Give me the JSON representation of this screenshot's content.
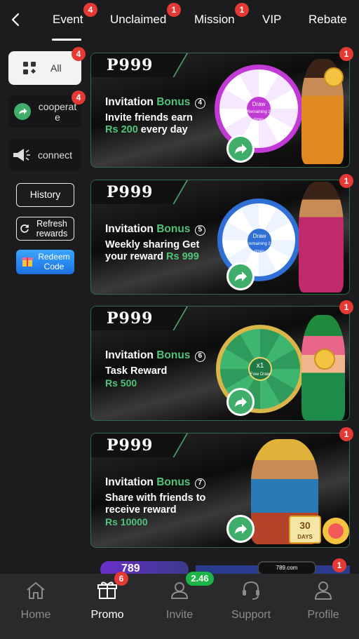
{
  "topbar": {
    "tabs": [
      {
        "label": "Event",
        "badge": "4",
        "active": true
      },
      {
        "label": "Unclaimed",
        "badge": "1"
      },
      {
        "label": "Mission",
        "badge": "1"
      },
      {
        "label": "VIP",
        "badge": ""
      },
      {
        "label": "Rebate",
        "badge": ""
      }
    ]
  },
  "sidebar": {
    "all": {
      "label": "All",
      "badge": "4"
    },
    "cooperate": {
      "label": "cooperat e",
      "badge": "4"
    },
    "connect": {
      "label": "connect"
    },
    "history": "History",
    "refresh": "Refresh rewards",
    "redeem": "Redeem Code"
  },
  "cards": [
    {
      "logo": "P999",
      "title_a": "Invitation ",
      "title_b": "Bonus",
      "num": "4",
      "line1": "Invite friends earn",
      "line2_a": "Rs 200",
      "line2_b": " every day",
      "amount": "",
      "badge": "1",
      "wheel_text": "Draw",
      "wheel_sub": "Remaining 2 times"
    },
    {
      "logo": "P999",
      "title_a": "Invitation ",
      "title_b": "Bonus",
      "num": "5",
      "line1": "Weekly sharing Get",
      "line2_a": "your reward ",
      "line2_b": "Rs 999",
      "amount": "",
      "badge": "1",
      "wheel_text": "Draw",
      "wheel_sub": "remaining 2 times"
    },
    {
      "logo": "P999",
      "title_a": "Invitation ",
      "title_b": "Bonus",
      "num": "6",
      "line1": "Task Reward",
      "line2_a": "",
      "line2_b": "",
      "amount": "Rs 500",
      "badge": "1",
      "wheel_text": "x1",
      "wheel_sub": "Free Draw"
    },
    {
      "logo": "P999",
      "title_a": "Invitation ",
      "title_b": "Bonus",
      "num": "7",
      "line1": "Share with friends to",
      "line2_a": "receive reward",
      "line2_b": "",
      "amount": "Rs 10000",
      "badge": "1",
      "wheel_text": "30",
      "wheel_sub": "DAYS"
    }
  ],
  "strip": {
    "text_left": "789",
    "text_right": "789.com",
    "badge": "1"
  },
  "bottomnav": {
    "items": [
      {
        "label": "Home",
        "icon": "home-icon"
      },
      {
        "label": "Promo",
        "icon": "gift-icon",
        "badge": "6",
        "active": true
      },
      {
        "label": "Invite",
        "icon": "invite-icon",
        "badge": "2.46"
      },
      {
        "label": "Support",
        "icon": "headset-icon"
      },
      {
        "label": "Profile",
        "icon": "person-icon"
      }
    ]
  },
  "colors": {
    "accent_green": "#4fc47a",
    "badge_red": "#e53935",
    "redeem_blue": "#1b6fe0"
  }
}
